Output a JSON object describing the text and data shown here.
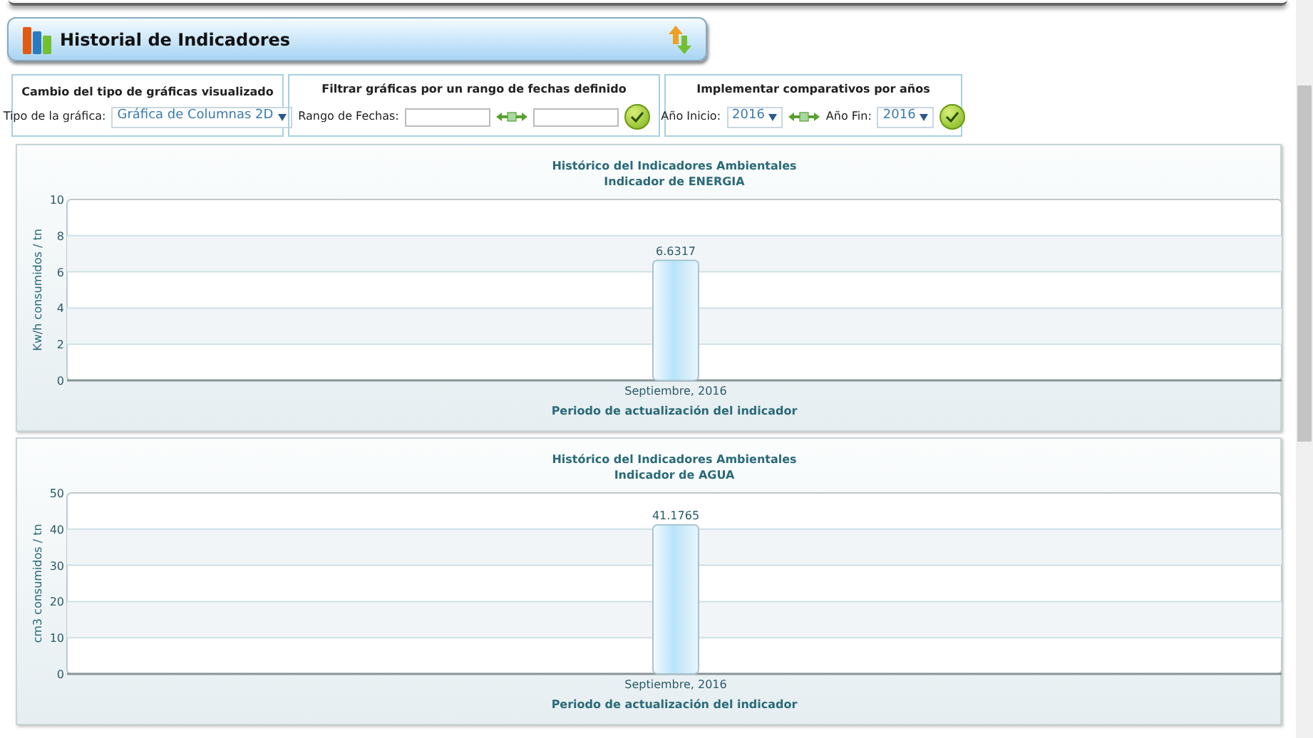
{
  "header": {
    "title": "Historial de Indicadores"
  },
  "filters": [
    {
      "kind": "type",
      "heading": "Cambio del tipo de gráficas visualizado",
      "label": "Tipo de la gráfica:",
      "value": "Gráfica de Columnas 2D"
    },
    {
      "kind": "range",
      "heading": "Filtrar gráficas por un rango de fechas definido",
      "label": "Rango de Fechas:"
    },
    {
      "kind": "years",
      "heading": "Implementar comparativos por años",
      "label": "Año Inicio:",
      "value": "2016",
      "label_2": "Año Fin:",
      "value_2": "2016"
    }
  ],
  "charts": [
    {
      "chart_data": {
        "type": "bar",
        "title": "Histórico del Indicadores Ambientales",
        "subtitle": "Indicador de ENERGIA",
        "xlabel": "Periodo de actualización del indicador",
        "ylabel": "Kw/h consumidos / tn",
        "categories": [
          "Septiembre, 2016"
        ],
        "values": [
          6.6317
        ],
        "value_labels": [
          "6.6317"
        ],
        "ylim": [
          0,
          10
        ],
        "grid": true,
        "yticks": [
          0,
          2,
          4,
          6,
          8,
          10
        ]
      }
    },
    {
      "chart_data": {
        "type": "bar",
        "title": "Histórico del Indicadores Ambientales",
        "subtitle": "Indicador de AGUA",
        "xlabel": "Periodo de actualización del indicador",
        "ylabel": "cm3 consumidos / tn",
        "categories": [
          "Septiembre, 2016"
        ],
        "values": [
          41.1765
        ],
        "value_labels": [
          "41.1765"
        ],
        "ylim": [
          0,
          50
        ],
        "grid": true,
        "yticks": [
          0,
          10,
          20,
          30,
          40,
          50
        ]
      }
    }
  ]
}
